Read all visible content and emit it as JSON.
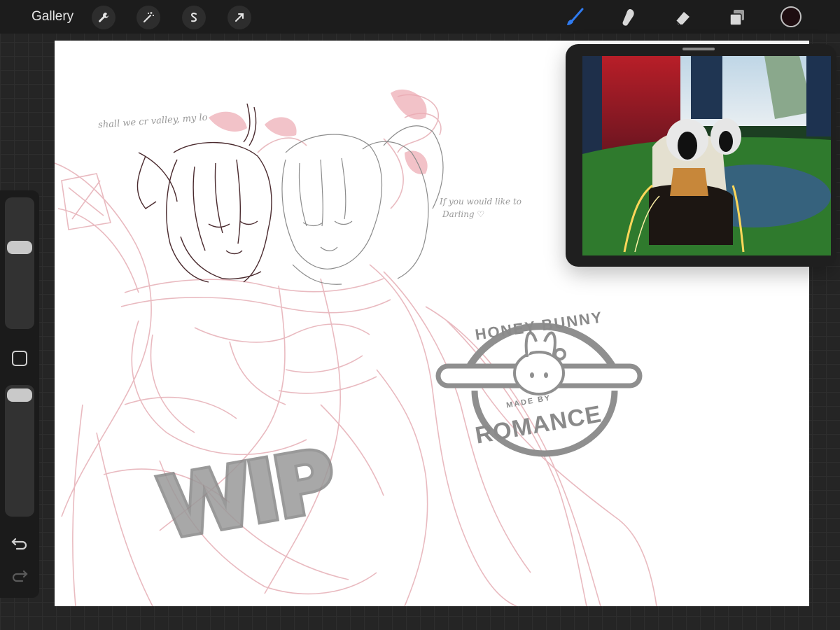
{
  "topbar": {
    "gallery_label": "Gallery",
    "left_tools": [
      "wrench-icon",
      "magic-wand-icon",
      "selection-s-icon",
      "transform-arrow-icon"
    ],
    "right_tools": [
      "brush-icon",
      "smudge-icon",
      "eraser-icon",
      "layers-icon"
    ],
    "active_tool": "brush-icon",
    "accent_color": "#2f7bf0",
    "current_color": "#1e0d10"
  },
  "sidebar": {
    "brush_size_level": 0.35,
    "opacity_level": 0.05,
    "buttons": [
      "modify-square",
      "undo-icon",
      "redo-icon"
    ]
  },
  "canvas": {
    "note_left": "shall we cr valley, my lo",
    "note_right_line1": "If you would like to",
    "note_right_line2": "Darling ♡",
    "watermark_wip": "WIP",
    "stamp_top": "HONEY BUNNY",
    "stamp_mid": "MADE BY",
    "stamp_bottom": "ROMANCE",
    "sketch_color": "#e8b7bd",
    "lineart_color": "#4a2a2e"
  },
  "reference": {
    "description_icon": "reference-image-icon"
  }
}
